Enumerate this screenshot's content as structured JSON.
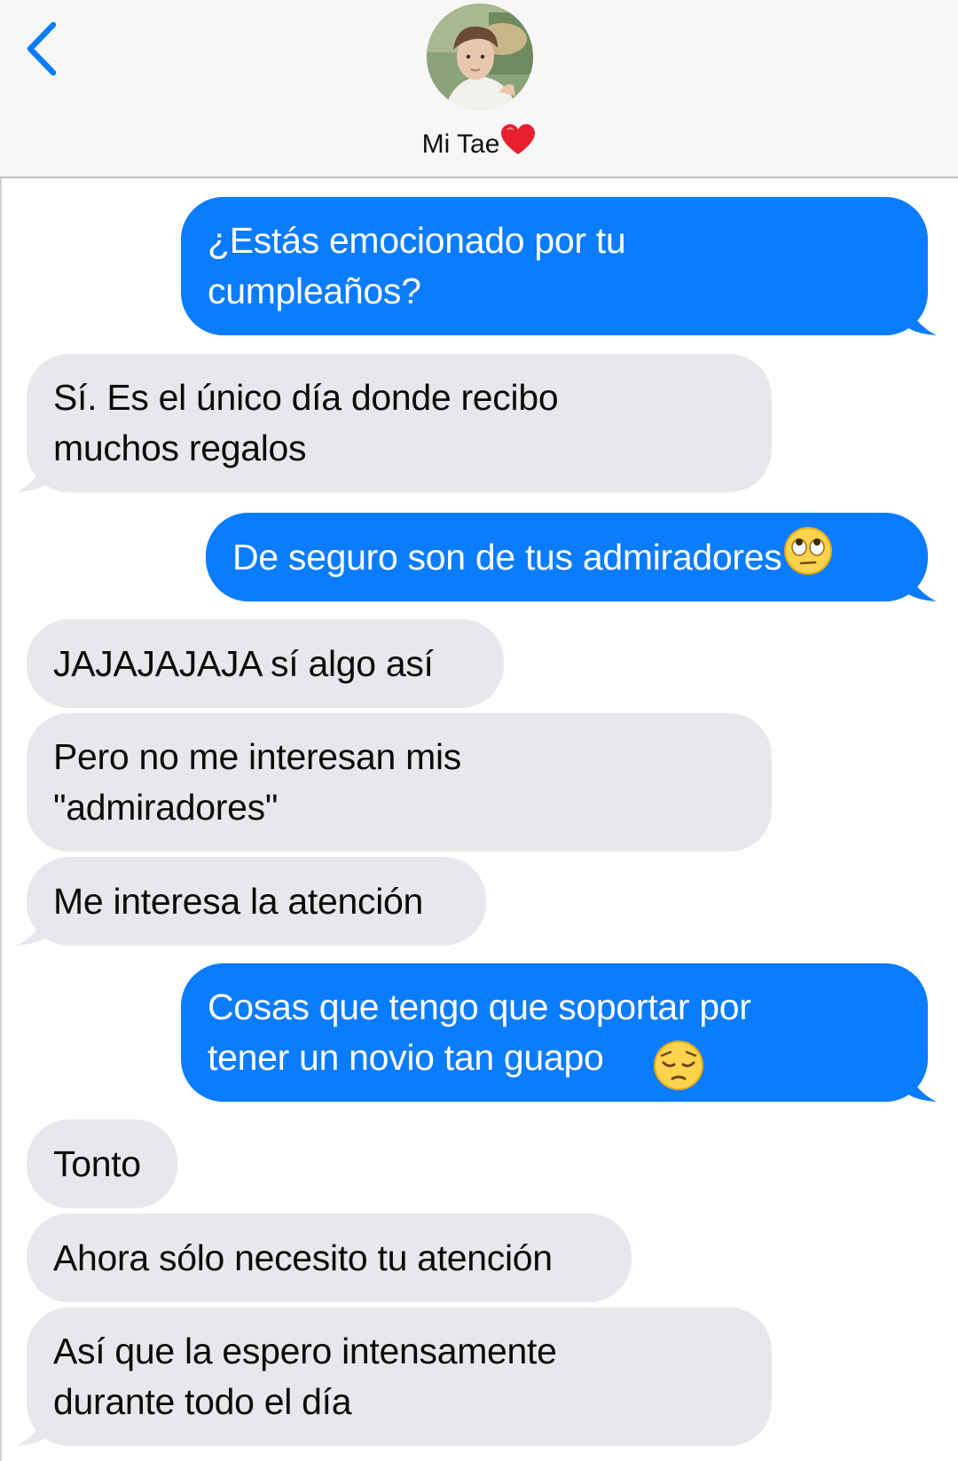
{
  "header": {
    "back_icon": "chevron-left-icon",
    "contact_name": "Mi Tae",
    "contact_emoji": "heart-icon",
    "accent_color": "#0a7cff"
  },
  "messages": [
    {
      "direction": "outgoing",
      "text": "¿Estás emocionado por tu\ncumpleaños?"
    },
    {
      "direction": "incoming",
      "text": "Sí. Es el único día donde recibo\nmuchos regalos"
    },
    {
      "direction": "outgoing",
      "text": "De seguro son de tus admiradores",
      "emoji": "eye-roll-emoji"
    },
    {
      "direction": "incoming",
      "text": "JAJAJAJAJA sí algo así"
    },
    {
      "direction": "incoming",
      "text": "Pero no me interesan mis\n\"admiradores\""
    },
    {
      "direction": "incoming",
      "text": "Me interesa la atención"
    },
    {
      "direction": "outgoing",
      "text": "Cosas que tengo que soportar por\ntener un novio tan guapo ",
      "emoji": "pensive-face-emoji"
    },
    {
      "direction": "incoming",
      "text": "Tonto"
    },
    {
      "direction": "incoming",
      "text": "Ahora sólo necesito tu atención"
    },
    {
      "direction": "incoming",
      "text": "Así que la espero intensamente\ndurante todo el día"
    }
  ],
  "colors": {
    "outgoing_bubble": "#0a7cff",
    "incoming_bubble": "#e8e8ec",
    "header_bg": "#f7f7f7"
  }
}
